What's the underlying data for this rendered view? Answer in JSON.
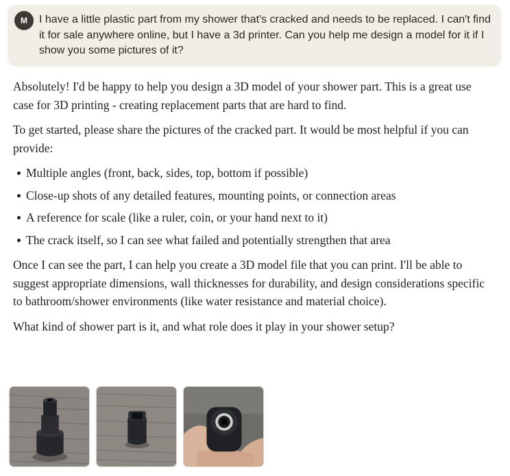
{
  "user_message": {
    "avatar_initial": "M",
    "text": "I have a little plastic part from my shower that's cracked and needs to be replaced.  I can't find it for sale anywhere online, but I have a 3d printer.  Can you help me design a model for it if I show you some pictures of it?"
  },
  "response": {
    "intro": "Absolutely! I'd be happy to help you design a 3D model of your shower part. This is a great use case for 3D printing - creating replacement parts that are hard to find.",
    "request": "To get started, please share the pictures of the cracked part. It would be most helpful if you can provide:",
    "bullets": [
      "Multiple angles (front, back, sides, top, bottom if possible)",
      "Close-up shots of any detailed features, mounting points, or connection areas",
      "A reference for scale (like a ruler, coin, or your hand next to it)",
      "The crack itself, so I can see what failed and potentially strengthen that area"
    ],
    "followup": "Once I can see the part, I can help you create a 3D model file that you can print. I'll be able to suggest appropriate dimensions, wall thicknesses for durability, and design considerations specific to bathroom/shower environments (like water resistance and material choice).",
    "question": "What kind of shower part is it, and what role does it play in your shower setup?"
  },
  "attachments": [
    {
      "name": "photo-part-upright"
    },
    {
      "name": "photo-part-square-opening"
    },
    {
      "name": "photo-part-in-hand"
    }
  ]
}
